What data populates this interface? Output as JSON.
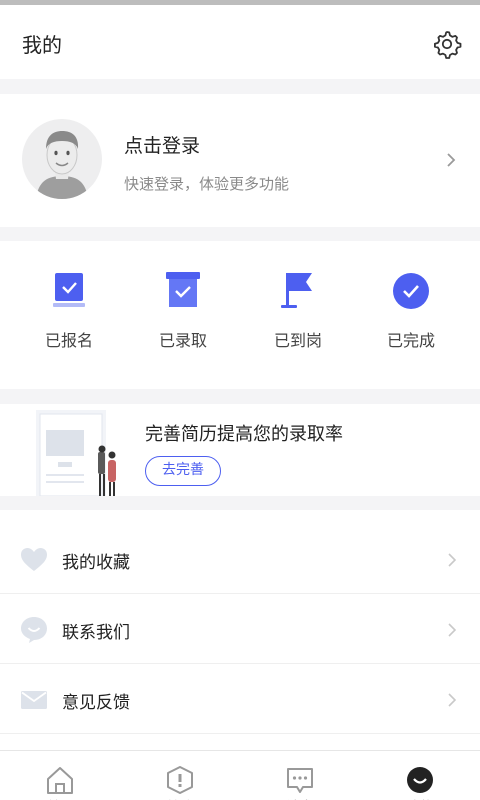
{
  "header": {
    "title": "我的"
  },
  "profile": {
    "login_title": "点击登录",
    "login_subtitle": "快速登录，体验更多功能"
  },
  "status_items": [
    {
      "label": "已报名",
      "icon": "clipboard-check-icon"
    },
    {
      "label": "已录取",
      "icon": "box-check-icon"
    },
    {
      "label": "已到岗",
      "icon": "flag-icon"
    },
    {
      "label": "已完成",
      "icon": "check-circle-icon"
    }
  ],
  "resume": {
    "title": "完善简历提高您的录取率",
    "button": "去完善"
  },
  "menu": [
    {
      "label": "我的收藏",
      "icon": "heart-icon"
    },
    {
      "label": "联系我们",
      "icon": "chat-smile-icon"
    },
    {
      "label": "意见反馈",
      "icon": "mail-icon"
    }
  ],
  "tabs": [
    {
      "label": "首页",
      "icon": "home-icon"
    },
    {
      "label": "精选",
      "icon": "compass-icon"
    },
    {
      "label": "消息",
      "icon": "message-icon"
    },
    {
      "label": "我的",
      "icon": "profile-icon",
      "active": true
    }
  ],
  "colors": {
    "accent": "#4d5ff0",
    "background": "#f4f4f6"
  }
}
